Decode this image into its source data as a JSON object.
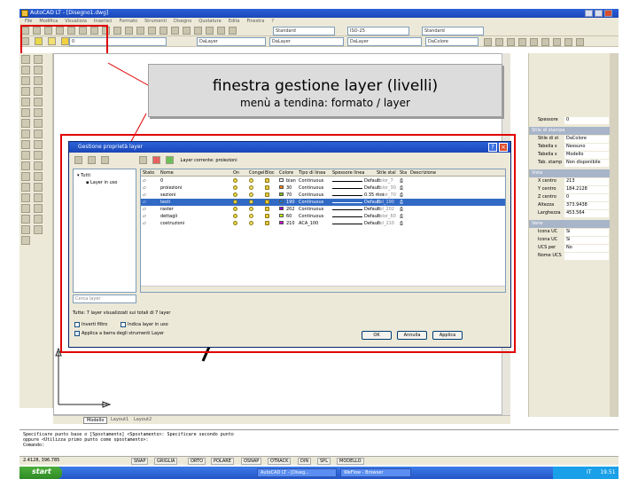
{
  "window": {
    "title": "AutoCAD LT - [Disegno1.dwg]"
  },
  "menu": [
    "File",
    "Modifica",
    "Visualizza",
    "Inserisci",
    "Formato",
    "Strumenti",
    "Disegno",
    "Quotatura",
    "Edita",
    "Finestra",
    "?"
  ],
  "styles_toolbar": {
    "text_style": "Standard",
    "dim_style": "ISO-25",
    "table_style": "Standard"
  },
  "layers_toolbar": {
    "layer_current": "0"
  },
  "properties_toolbar": {
    "layer": "DaLayer",
    "color": "DaLayer",
    "linetype": "DaLayer",
    "lineweight": "DaLayer",
    "plot_style": "DaColore"
  },
  "annotation": {
    "title": "finestra gestione layer (livelli)",
    "subtitle": "menù a tendina: formato / layer"
  },
  "dialog": {
    "title": "Gestione proprietà layer",
    "current_layer_label": "Layer corrente: proiezioni",
    "tree": {
      "root": "Tutti",
      "child": "Layer in uso"
    },
    "search_placeholder": "Cerca layer",
    "columns": [
      "Stato",
      "Nome",
      "On",
      "Congel",
      "Bloc",
      "Colore",
      "Tipo di linea",
      "Spessore linea",
      "Stile stal",
      "Sta",
      "Descrizione"
    ],
    "rows": [
      {
        "name": "0",
        "color_name": "bian",
        "color_hex": "#ffffff",
        "linetype": "Continuous",
        "lineweight": "Default",
        "plot_style": "Color_7",
        "selected": false
      },
      {
        "name": "proiezioni",
        "color_name": "30",
        "color_hex": "#ff7f00",
        "linetype": "Continuous",
        "lineweight": "Default",
        "plot_style": "Color_30",
        "selected": false
      },
      {
        "name": "sezioni",
        "color_name": "70",
        "color_hex": "#7fbf00",
        "linetype": "Continuous",
        "lineweight": "0.35 mm",
        "plot_style": "Color_70",
        "selected": false
      },
      {
        "name": "testi",
        "color_name": "190",
        "color_hex": "#007fff",
        "linetype": "Continuous",
        "lineweight": "Default",
        "plot_style": "Col_190",
        "selected": true
      },
      {
        "name": "raster",
        "color_name": "202",
        "color_hex": "#9a00cc",
        "linetype": "Continuous",
        "lineweight": "Default",
        "plot_style": "Col_202",
        "selected": false
      },
      {
        "name": "dettagli",
        "color_name": "60",
        "color_hex": "#bfff00",
        "linetype": "Continuous",
        "lineweight": "Default",
        "plot_style": "Color_60",
        "selected": false
      },
      {
        "name": "costruzioni",
        "color_name": "210",
        "color_hex": "#cc00cc",
        "linetype": "ACA_100",
        "lineweight": "Default",
        "plot_style": "Col_210",
        "selected": false
      }
    ],
    "status_line": "Tutte: 7 layer visualizzati sui totali di 7 layer",
    "options": {
      "invert_filter": "Inverti filtro",
      "show_used": "Indica layer in uso",
      "apply_toolbar": "Applica a barra degli strumenti Layer"
    },
    "buttons": {
      "ok": "OK",
      "cancel": "Annulla",
      "apply": "Applica",
      "help": "?"
    }
  },
  "properties_panel": {
    "rows_general": [
      {
        "key": "Spessore",
        "value": "0"
      }
    ],
    "group_plot": "Stile di stampa",
    "rows_plot": [
      {
        "key": "Stile di st",
        "value": "DaColore"
      },
      {
        "key": "Tabella s",
        "value": "Nessuno"
      },
      {
        "key": "Tabella s",
        "value": "Modello"
      },
      {
        "key": "Tab. stamp",
        "value": "Non disponibile"
      }
    ],
    "group_view": "Vista",
    "rows_view": [
      {
        "key": "X centro",
        "value": "213"
      },
      {
        "key": "Y centro",
        "value": "184.2128"
      },
      {
        "key": "Z centro",
        "value": "0"
      },
      {
        "key": "Altezza",
        "value": "373.9438"
      },
      {
        "key": "Larghezza",
        "value": "453.564"
      }
    ],
    "group_misc": "Varie",
    "rows_misc": [
      {
        "key": "Icona UC",
        "value": "Sì"
      },
      {
        "key": "Icona UC",
        "value": "Sì"
      },
      {
        "key": "UCS per",
        "value": "No"
      },
      {
        "key": "Nome UCS",
        "value": ""
      }
    ]
  },
  "layout_tabs": [
    "Modello",
    "Layout1",
    "Layout2"
  ],
  "command_line": [
    "Specificare punto base o [Spostamento] <Spostamento>: Specificare secondo punto",
    "oppure <Utilizza primo punto come spostamento>:",
    "Comando:"
  ],
  "status_bar": {
    "coords": "2.4128, 396.785",
    "toggles": [
      "SNAP",
      "GRIGLIA",
      "ORTO",
      "POLARE",
      "OSNAP",
      "OTRACK",
      "DIN",
      "SPL",
      "MODELLO"
    ]
  },
  "taskbar": {
    "start": "start",
    "tasks": [
      "AutoCAD LT - [Diseg...",
      "WeFlow - Browser"
    ],
    "lang": "IT",
    "clock": "19.51"
  }
}
